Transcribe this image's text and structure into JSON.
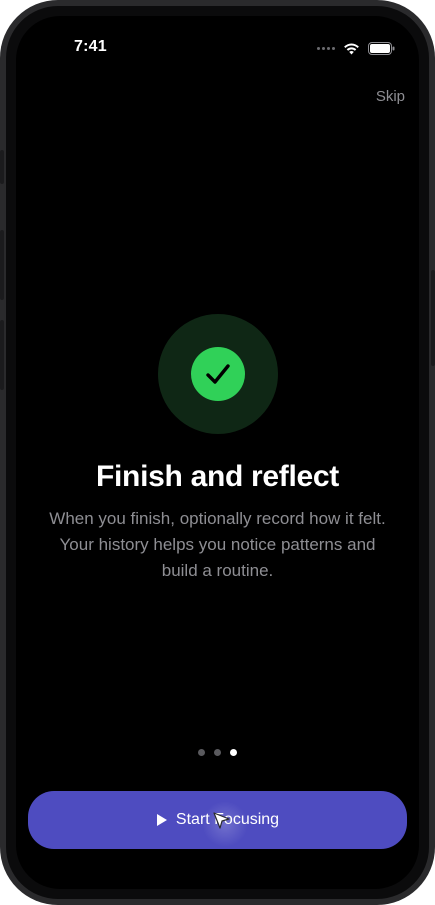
{
  "status_bar": {
    "time": "7:41",
    "icons": [
      "signal-dots-icon",
      "wifi-icon",
      "battery-icon"
    ]
  },
  "header": {
    "skip_label": "Skip"
  },
  "onboarding": {
    "icon": "checkmark-circle-icon",
    "title": "Finish and reflect",
    "description": "When you finish, optionally record how it felt. Your history helps you notice patterns and build a routine.",
    "page_count": 3,
    "current_page": 3
  },
  "cta": {
    "label": "Start Focusing",
    "icon": "play-icon"
  },
  "colors": {
    "background": "#000000",
    "accent": "#4e4cc0",
    "success": "#30d158",
    "success_halo": "#0f2715",
    "muted_text": "#8e8e93"
  }
}
